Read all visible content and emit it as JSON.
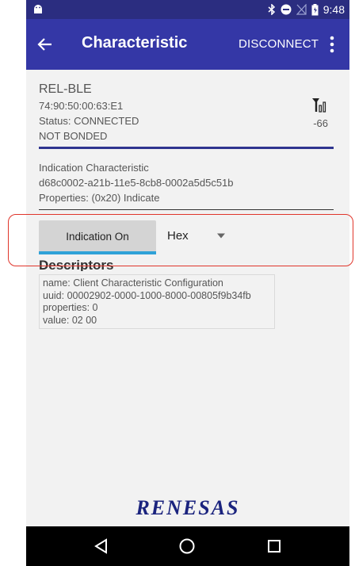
{
  "status_bar": {
    "time": "9:48",
    "icons": [
      "android-icon",
      "bluetooth-icon",
      "dnd-icon",
      "no-sim-icon",
      "battery-icon"
    ]
  },
  "toolbar": {
    "title": "Characteristic",
    "disconnect_label": "DISCONNECT",
    "back_icon": "arrow-left-icon",
    "more_icon": "more-vert-icon"
  },
  "device": {
    "name": "REL-BLE",
    "address": "74:90:50:00:63:E1",
    "status": "Status: CONNECTED",
    "bond": "NOT BONDED",
    "rssi": "-66"
  },
  "characteristic": {
    "name": "Indication Characteristic",
    "uuid": "d68c0002-a21b-11e5-8cb8-0002a5d5c51b",
    "properties": "Properties: (0x20) Indicate"
  },
  "controls": {
    "indication_button": "Indication On",
    "format_selected": "Hex"
  },
  "descriptors": {
    "title": "Descriptors",
    "items": [
      {
        "name": "name: Client Characteristic Configuration",
        "uuid": "uuid: 00002902-0000-1000-8000-00805f9b34fb",
        "properties": "properties: 0",
        "value": "value: 02 00"
      }
    ]
  },
  "logo": "RENESAS",
  "colors": {
    "toolbar": "#3437a6",
    "status_bar": "#2b2d80",
    "accent": "#2fa2d8",
    "highlight": "#e0352b"
  }
}
